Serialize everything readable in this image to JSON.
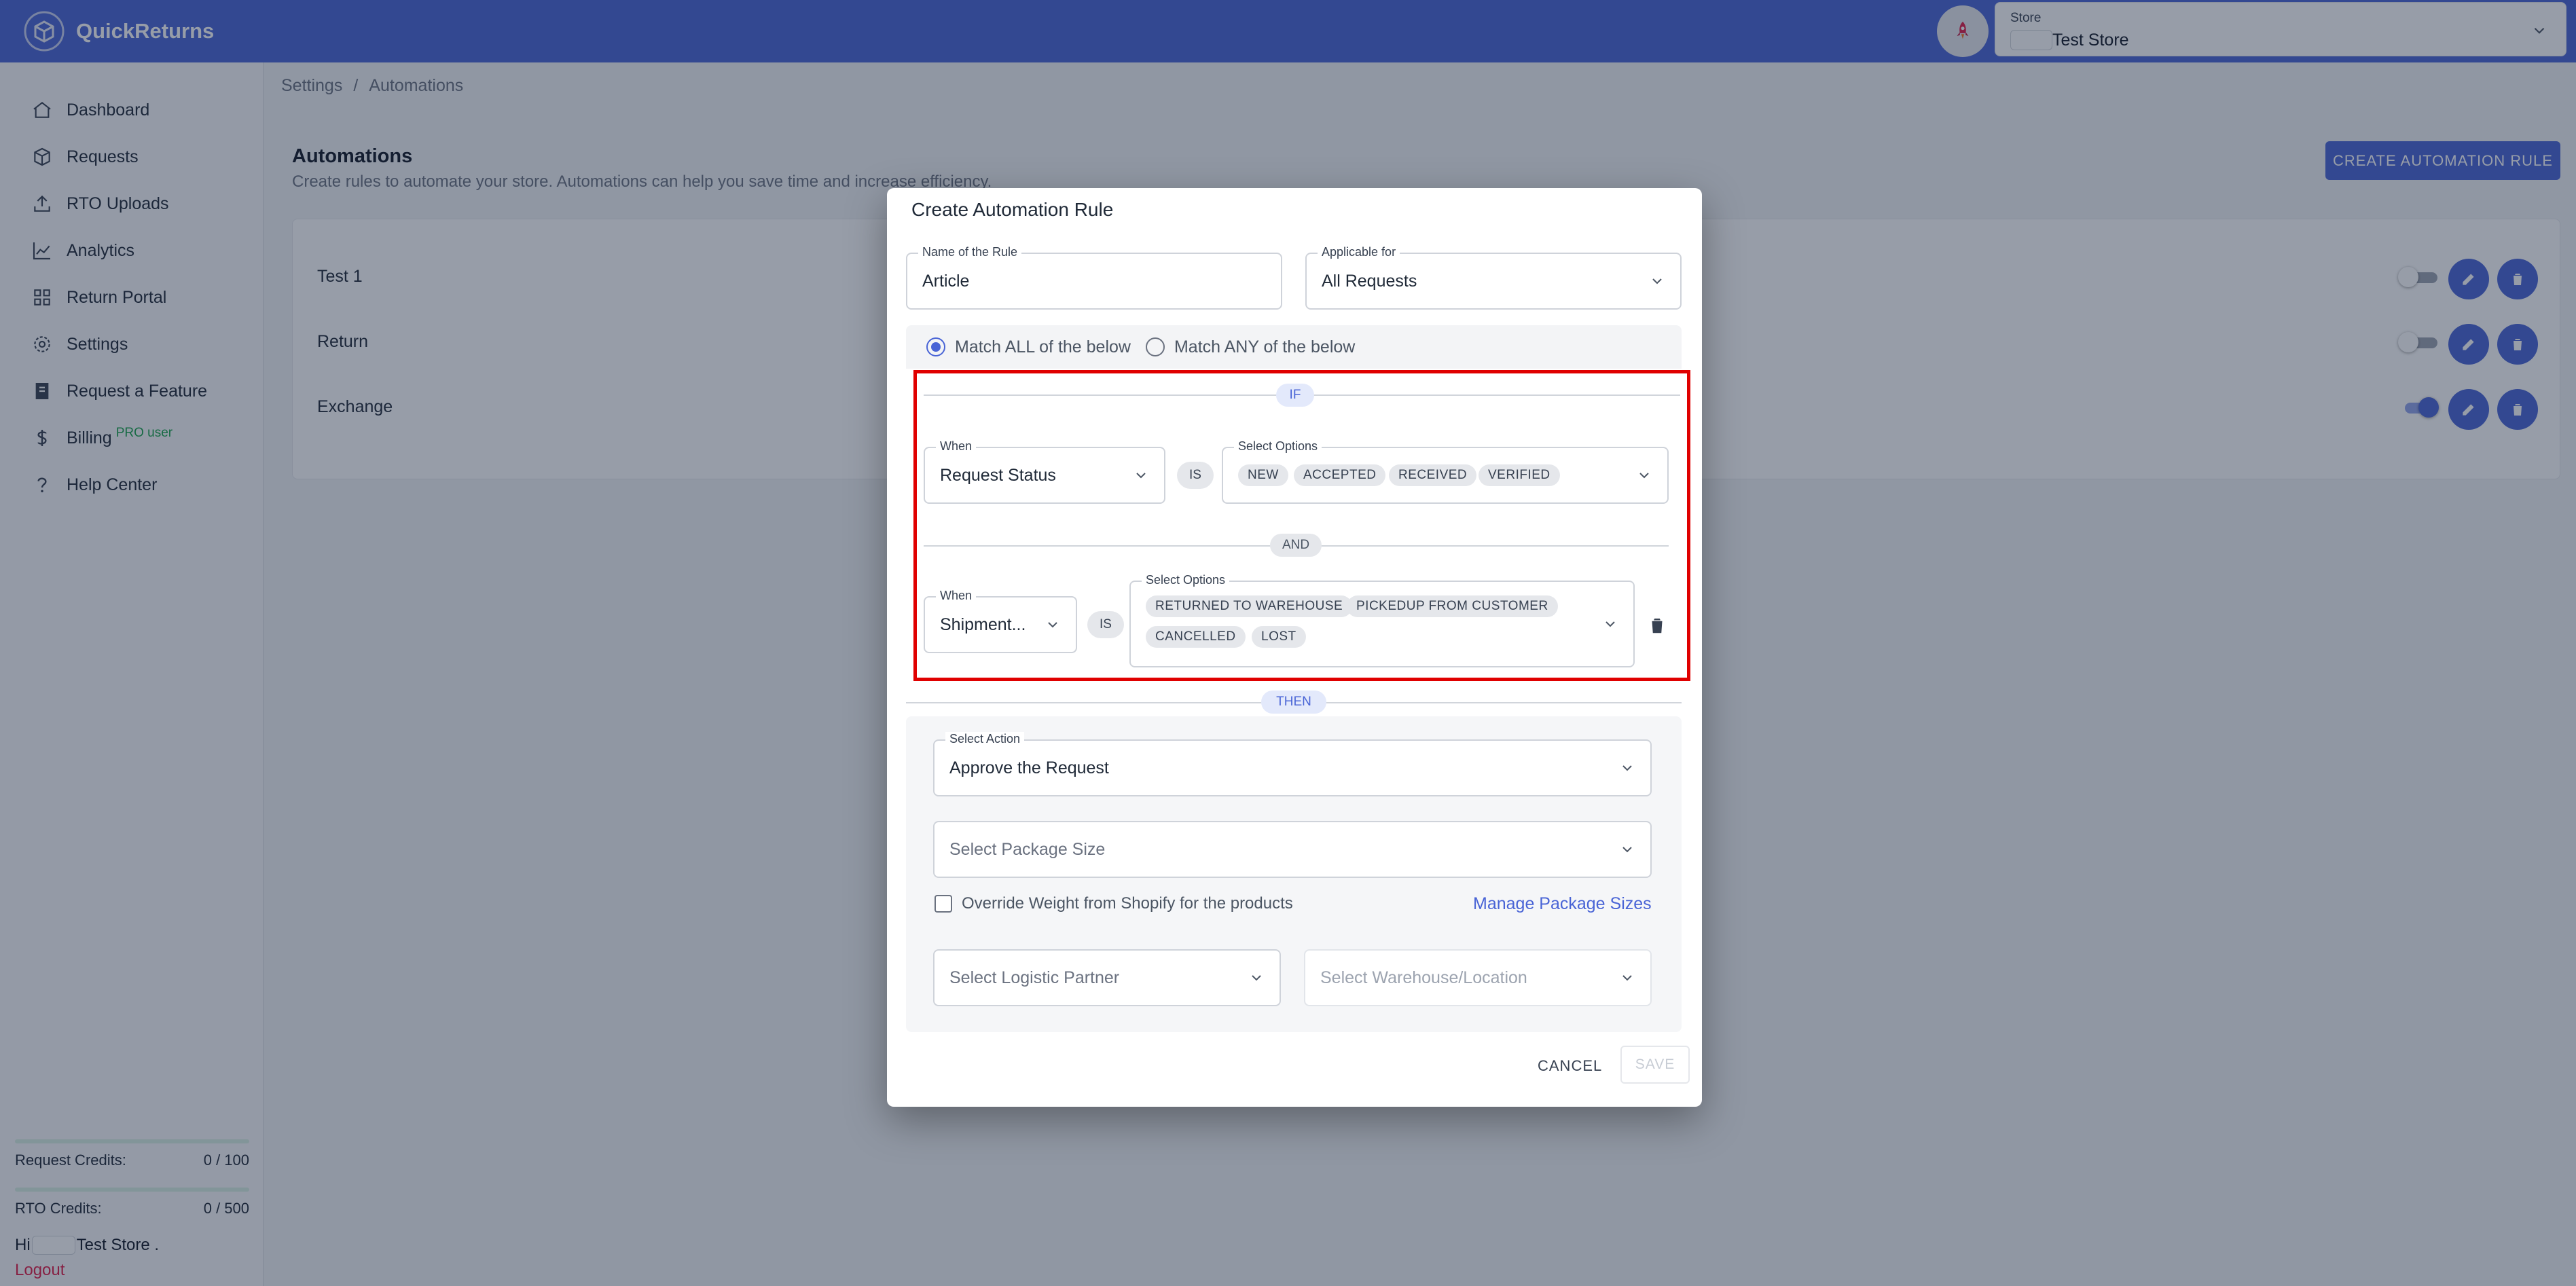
{
  "app": {
    "name": "QuickReturns"
  },
  "header": {
    "store_label": "Store",
    "store_value": "Test Store"
  },
  "sidebar": {
    "items": [
      {
        "label": "Dashboard",
        "icon": "home-icon"
      },
      {
        "label": "Requests",
        "icon": "box-icon"
      },
      {
        "label": "RTO Uploads",
        "icon": "upload-icon"
      },
      {
        "label": "Analytics",
        "icon": "chart-line-icon"
      },
      {
        "label": "Return Portal",
        "icon": "grid-icon"
      },
      {
        "label": "Settings",
        "icon": "gear-icon"
      },
      {
        "label": "Request a Feature",
        "icon": "feature-icon"
      },
      {
        "label": "Billing",
        "icon": "dollar-icon",
        "badge": "PRO user"
      },
      {
        "label": "Help Center",
        "icon": "question-icon"
      }
    ],
    "credits": {
      "request_label": "Request Credits:",
      "request_value": "0 / 100",
      "rto_label": "RTO Credits:",
      "rto_value": "0 / 500"
    },
    "user": {
      "greeting": "Hi",
      "name": "Test Store .",
      "logout": "Logout"
    }
  },
  "main": {
    "breadcrumb": [
      "Settings",
      "Automations"
    ],
    "title": "Automations",
    "subtitle": "Create rules to automate your store. Automations can help you save time and increase efficiency.",
    "create_button": "CREATE AUTOMATION RULE",
    "rules": [
      {
        "name": "Test 1",
        "enabled": false
      },
      {
        "name": "Return",
        "enabled": false
      },
      {
        "name": "Exchange",
        "enabled": true
      }
    ]
  },
  "modal": {
    "title": "Create Automation Rule",
    "rule_name": {
      "label": "Name of the Rule",
      "value": "Article"
    },
    "applicable_for": {
      "label": "Applicable for",
      "value": "All Requests"
    },
    "match_all": "Match ALL of the below",
    "match_any": "Match ANY of the below",
    "match_mode": "all",
    "if_label": "IF",
    "and_label": "AND",
    "then_label": "THEN",
    "is_label": "IS",
    "conditions": [
      {
        "when_label": "When",
        "when_value": "Request Status",
        "options_label": "Select Options",
        "options": [
          "NEW",
          "ACCEPTED",
          "RECEIVED",
          "VERIFIED"
        ]
      },
      {
        "when_label": "When",
        "when_value": "Shipment...",
        "options_label": "Select Options",
        "options": [
          "RETURNED TO WAREHOUSE",
          "PICKEDUP FROM CUSTOMER",
          "CANCELLED",
          "LOST"
        ]
      }
    ],
    "action": {
      "label": "Select Action",
      "value": "Approve the Request"
    },
    "package_size_placeholder": "Select Package Size",
    "override_weight": "Override Weight from Shopify for the products",
    "manage_package_sizes": "Manage Package Sizes",
    "logistic_partner_placeholder": "Select Logistic Partner",
    "warehouse_placeholder": "Select Warehouse/Location",
    "cancel": "CANCEL",
    "save": "SAVE"
  }
}
